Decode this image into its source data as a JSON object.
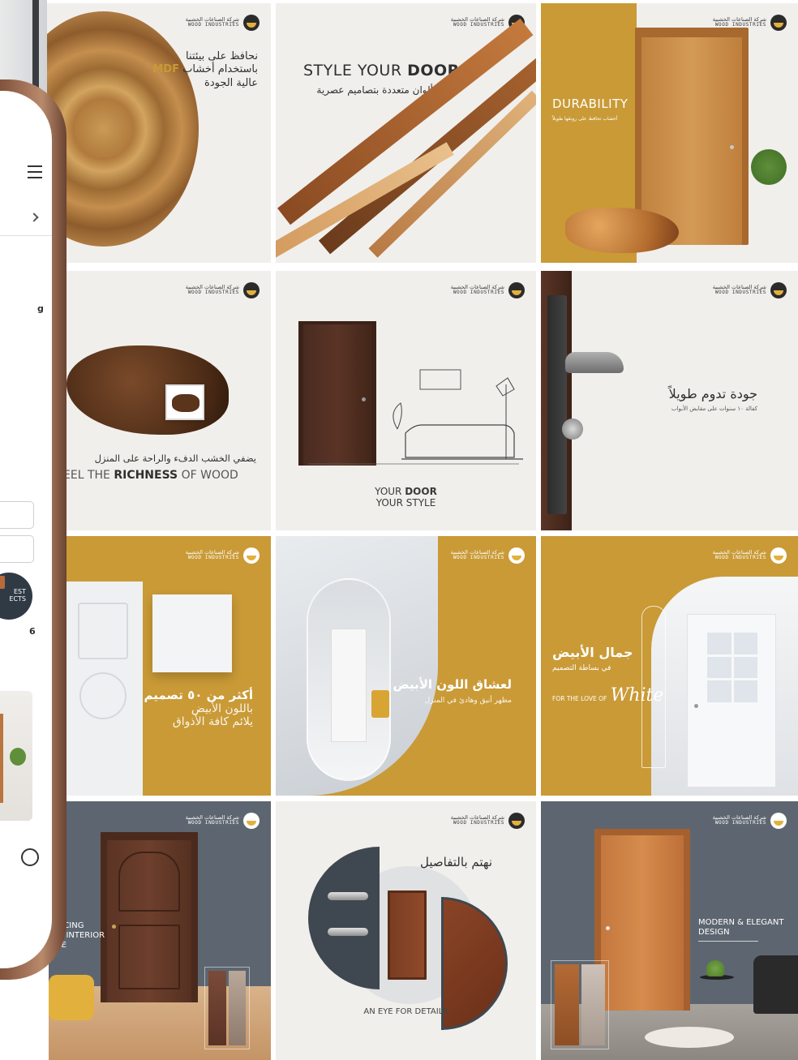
{
  "brand": {
    "ar": "شركة الصناعات الخشبية",
    "en": "WOOD INDUSTRIES"
  },
  "tiles": {
    "t1": {
      "line1": "نحافظ على بيئتنا",
      "line2_ar": "باستخدام أخشاب",
      "line2_en": "MDF",
      "line3": "عالية الجودة"
    },
    "t2": {
      "en_light": "STYLE YOUR ",
      "en_bold": "DOOR",
      "ar": "ألوان متعددة بتصاميم عصرية"
    },
    "t3": {
      "en": "DURABILITY",
      "ar": "أخشاب تحافظ على رونقها طويلاً"
    },
    "t4": {
      "ar": "يضفي الخشب الدفء والراحة على المنزل",
      "en_pre": "EEL THE ",
      "en_bold": "RICHNESS",
      "en_post": " OF WOOD"
    },
    "t5": {
      "line1_light": "YOUR ",
      "line1_bold": "DOOR",
      "line2": "YOUR STYLE"
    },
    "t6": {
      "ar": "جودة تدوم طويلاً",
      "sub": "كفالة ١٠ سنوات على مقابض الأبواب"
    },
    "t7": {
      "line1": "أكثر من ٥٠ تصميم",
      "line2": "باللون الأبيض",
      "line3": "يلائم كافة الأذواق"
    },
    "t8": {
      "line1": "لعشاق اللون الأبيض",
      "line2": "مظهر أنيق وهادئ في المنزل"
    },
    "t9": {
      "line1": "جمال الأبيض",
      "line2": "في بساطة التصميم",
      "en": "FOR THE LOVE OF",
      "script": "White"
    },
    "t10": {
      "line1": "ANCING",
      "line2": "UR INTERIOR",
      "line3": "YLE"
    },
    "t11": {
      "ar": "نهتم بالتفاصيل",
      "en": "AN EYE FOR DETAILS"
    },
    "t12": {
      "line1": "MODERN & ELEGANT",
      "line2": "DESIGN"
    }
  },
  "phone": {
    "circle_line1": "EST",
    "circle_line2": "ECTS",
    "label_g": "g",
    "label_6": "6"
  },
  "icons": [
    "menu-icon",
    "chevron-right-icon",
    "logo-icon"
  ]
}
